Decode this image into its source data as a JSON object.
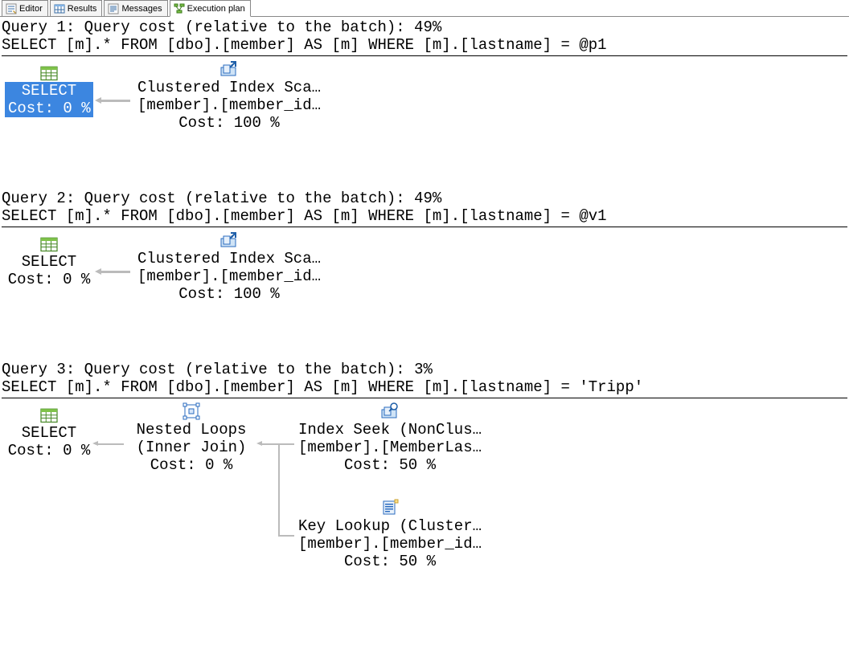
{
  "tabs": {
    "editor": "Editor",
    "results": "Results",
    "messages": "Messages",
    "plan": "Execution plan"
  },
  "queries": [
    {
      "header": "Query 1: Query cost (relative to the batch): 49%",
      "sql": "SELECT [m].* FROM [dbo].[member] AS [m] WHERE [m].[lastname] = @p1",
      "selected": true,
      "nodes": {
        "select": {
          "line1": "SELECT",
          "line2": "Cost: 0 %"
        },
        "scan": {
          "line1": "Clustered Index Sca…",
          "line2": "[member].[member_id…",
          "line3": "Cost: 100 %"
        }
      }
    },
    {
      "header": "Query 2: Query cost (relative to the batch): 49%",
      "sql": "SELECT [m].* FROM [dbo].[member] AS [m] WHERE [m].[lastname] = @v1",
      "selected": false,
      "nodes": {
        "select": {
          "line1": "SELECT",
          "line2": "Cost: 0 %"
        },
        "scan": {
          "line1": "Clustered Index Sca…",
          "line2": "[member].[member_id…",
          "line3": "Cost: 100 %"
        }
      }
    },
    {
      "header": "Query 3: Query cost (relative to the batch): 3%",
      "sql": "SELECT [m].* FROM [dbo].[member] AS [m] WHERE [m].[lastname] = 'Tripp'",
      "selected": false,
      "nodes": {
        "select": {
          "line1": "SELECT",
          "line2": "Cost: 0 %"
        },
        "nested": {
          "line1": "Nested Loops",
          "line2": "(Inner Join)",
          "line3": "Cost: 0 %"
        },
        "seek": {
          "line1": "Index Seek (NonClus…",
          "line2": "[member].[MemberLas…",
          "line3": "Cost: 50 %"
        },
        "lookup": {
          "line1": "Key Lookup (Cluster…",
          "line2": "[member].[member_id…",
          "line3": "Cost: 50 %"
        }
      }
    }
  ]
}
